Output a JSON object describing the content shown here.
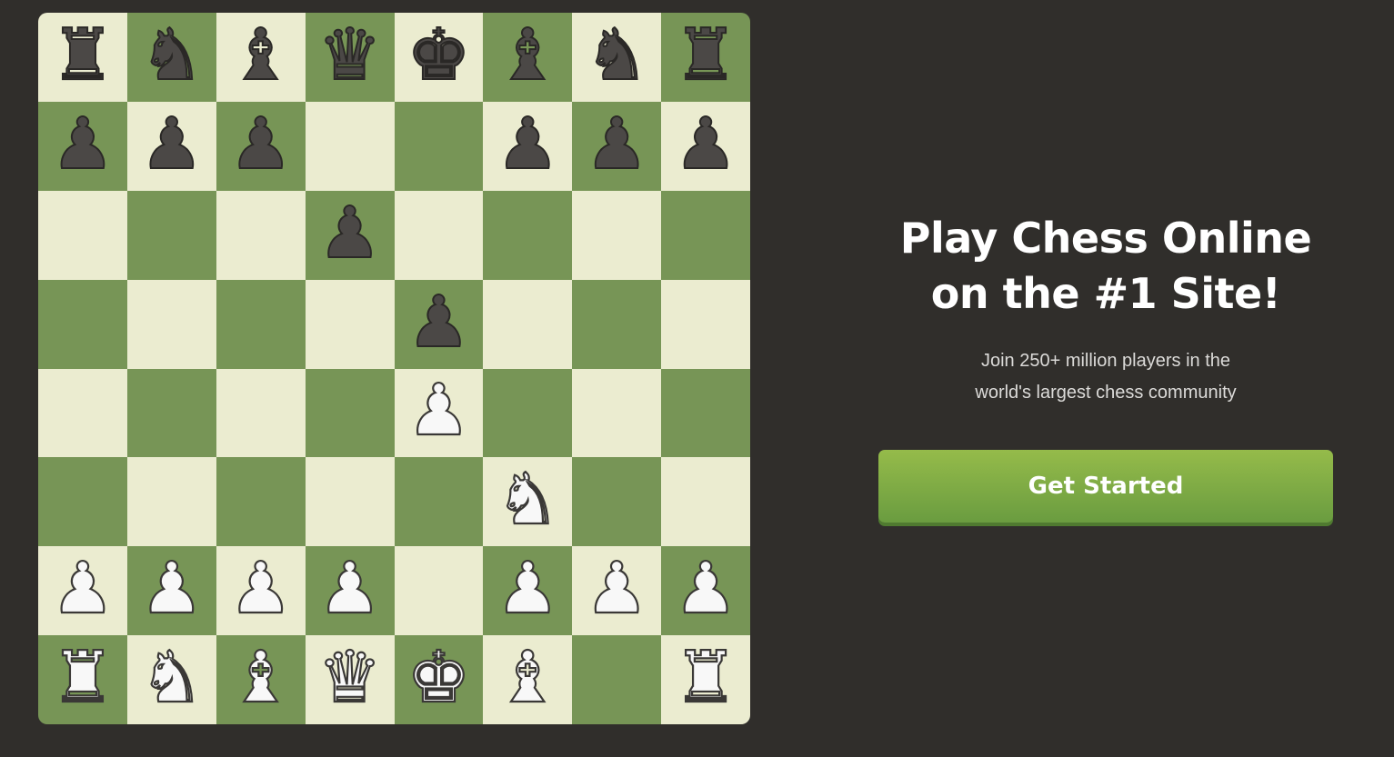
{
  "hero": {
    "title_line1": "Play Chess Online",
    "title_line2": "on the #1 Site!",
    "subtitle_line1": "Join 250+ million players in the",
    "subtitle_line2": "world's largest chess community",
    "cta_label": "Get Started"
  },
  "board": {
    "light_color": "#ebecd0",
    "dark_color": "#779556",
    "ranks": [
      [
        "br",
        "bn",
        "bb",
        "bq",
        "bk",
        "bb",
        "bn",
        "br"
      ],
      [
        "bp",
        "bp",
        "bp",
        "",
        "",
        "bp",
        "bp",
        "bp"
      ],
      [
        "",
        "",
        "",
        "bp",
        "",
        "",
        "",
        ""
      ],
      [
        "",
        "",
        "",
        "",
        "bp",
        "",
        "",
        ""
      ],
      [
        "",
        "",
        "",
        "",
        "wp",
        "",
        "",
        ""
      ],
      [
        "",
        "",
        "",
        "",
        "",
        "wn",
        "",
        ""
      ],
      [
        "wp",
        "wp",
        "wp",
        "wp",
        "",
        "wp",
        "wp",
        "wp"
      ],
      [
        "wr",
        "wn",
        "wb",
        "wq",
        "wk",
        "wb",
        "",
        "wr"
      ]
    ]
  }
}
